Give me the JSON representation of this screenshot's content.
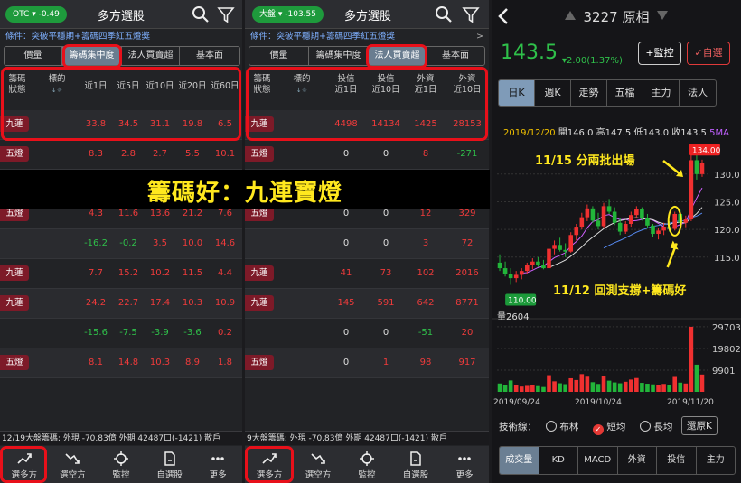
{
  "left": {
    "index_pill": "OTC ▾ -0.49",
    "title": "多方選股",
    "condition": "條件：突破平穩期+籌碼四季紅五燈獎",
    "tabs": [
      "價量",
      "籌碼集中度",
      "法人買賣超",
      "基本面"
    ],
    "active_tab": 1,
    "headers": [
      "籌碼\n狀態",
      "標的",
      "近1日",
      "近5日",
      "近10日",
      "近20日",
      "近60日"
    ],
    "rows": [
      {
        "status": "九蓮",
        "values": [
          "33.8",
          "34.5",
          "31.1",
          "19.8",
          "6.5"
        ]
      },
      {
        "status": "五燈",
        "values": [
          "8.3",
          "2.8",
          "2.7",
          "5.5",
          "10.1"
        ]
      },
      {
        "status": "",
        "values": [
          "",
          "",
          "",
          "",
          ""
        ]
      },
      {
        "status": "五燈",
        "values": [
          "4.3",
          "11.6",
          "13.6",
          "21.2",
          "7.6"
        ]
      },
      {
        "status": "",
        "values": [
          "-16.2",
          "-0.2",
          "3.5",
          "10.0",
          "14.6"
        ]
      },
      {
        "status": "九蓮",
        "values": [
          "7.7",
          "15.2",
          "10.2",
          "11.5",
          "4.4"
        ]
      },
      {
        "status": "九蓮",
        "values": [
          "24.2",
          "22.7",
          "17.4",
          "10.3",
          "10.9"
        ]
      },
      {
        "status": "",
        "values": [
          "-15.6",
          "-7.5",
          "-3.9",
          "-3.6",
          "0.2"
        ]
      },
      {
        "status": "五燈",
        "values": [
          "8.1",
          "14.8",
          "10.3",
          "8.9",
          "1.8"
        ]
      }
    ],
    "ticker": "12/19大盤籌碼: 外現 -70.83億 外期 42487口(-1421) 散戶",
    "nav": [
      "選多方",
      "選空方",
      "監控",
      "自選股",
      "更多"
    ]
  },
  "mid": {
    "index_pill": "大盤 ▾ -103.55",
    "title": "多方選股",
    "condition": "條件：突破平穩期+籌碼四季紅五燈獎",
    "tabs": [
      "價量",
      "籌碼集中度",
      "法人買賣超",
      "基本面"
    ],
    "active_tab": 2,
    "headers": [
      "籌碼\n狀態",
      "標的",
      "投信\n近1日",
      "投信\n近10日",
      "外資\n近1日",
      "外資\n近10日"
    ],
    "rows": [
      {
        "status": "九蓮",
        "values": [
          "4498",
          "14134",
          "1425",
          "28153"
        ]
      },
      {
        "status": "五燈",
        "values": [
          "0",
          "0",
          "8",
          "-271"
        ]
      },
      {
        "status": "",
        "values": [
          "",
          "",
          "",
          ""
        ]
      },
      {
        "status": "五燈",
        "values": [
          "0",
          "0",
          "12",
          "329"
        ]
      },
      {
        "status": "",
        "values": [
          "0",
          "0",
          "3",
          "72"
        ]
      },
      {
        "status": "九蓮",
        "values": [
          "41",
          "73",
          "102",
          "2016"
        ]
      },
      {
        "status": "九蓮",
        "values": [
          "145",
          "591",
          "642",
          "8771"
        ]
      },
      {
        "status": "",
        "values": [
          "0",
          "0",
          "-51",
          "20"
        ]
      },
      {
        "status": "五燈",
        "values": [
          "0",
          "1",
          "98",
          "917"
        ]
      }
    ],
    "ticker": "9大盤籌碼: 外現 -70.83億 外期 42487口(-1421) 散戶",
    "nav": [
      "選多方",
      "選空方",
      "監控",
      "自選股",
      "更多"
    ]
  },
  "banner": "籌碼好：九連寶燈",
  "right": {
    "title": "3227 原相",
    "price": "143.5",
    "change": "▾2.00(1.37%)",
    "monitor_btn": "+監控",
    "watch_btn": "✓自選",
    "tabs": [
      "日K",
      "週K",
      "走勢",
      "五檔",
      "主力",
      "法人"
    ],
    "ohlc_date": "2019/12/20",
    "ohlc_text": "開146.0 高147.5 低143.0 收143.5",
    "ohlc_ma": "5MA",
    "price_ticks": [
      "130.0",
      "125.0",
      "120.0",
      "115.0"
    ],
    "high_label": "134.00",
    "low_label": "110.00",
    "annotation_top": "11/15 分兩批出場",
    "annotation_bottom": "11/12 回測支撐+籌碼好",
    "volume_label": "量2604",
    "volume_ticks": [
      "29703",
      "19802",
      "9901"
    ],
    "dates": [
      "2019/09/24",
      "2019/10/24",
      "2019/11/20"
    ],
    "indicator_label": "技術線：",
    "ma_options": [
      "布林",
      "短均",
      "長均"
    ],
    "restore_btn": "還原K",
    "indicator_tabs": [
      "成交量",
      "KD",
      "MACD",
      "外資",
      "投信",
      "主力"
    ],
    "candles": [
      {
        "o": 114.0,
        "h": 115.5,
        "l": 112.5,
        "c": 113.0
      },
      {
        "o": 113.0,
        "h": 114.2,
        "l": 111.5,
        "c": 112.0
      },
      {
        "o": 112.0,
        "h": 113.0,
        "l": 110.0,
        "c": 111.2
      },
      {
        "o": 111.2,
        "h": 112.5,
        "l": 110.5,
        "c": 111.8
      },
      {
        "o": 111.8,
        "h": 113.0,
        "l": 111.0,
        "c": 112.5
      },
      {
        "o": 112.5,
        "h": 114.0,
        "l": 112.0,
        "c": 113.5
      },
      {
        "o": 113.5,
        "h": 114.8,
        "l": 112.8,
        "c": 114.2
      },
      {
        "o": 114.2,
        "h": 115.0,
        "l": 113.2,
        "c": 113.6
      },
      {
        "o": 113.6,
        "h": 114.5,
        "l": 112.8,
        "c": 113.0
      },
      {
        "o": 113.0,
        "h": 117.0,
        "l": 112.8,
        "c": 116.5
      },
      {
        "o": 116.5,
        "h": 118.0,
        "l": 115.5,
        "c": 117.2
      },
      {
        "o": 117.2,
        "h": 118.5,
        "l": 116.0,
        "c": 116.3
      },
      {
        "o": 116.3,
        "h": 117.5,
        "l": 115.0,
        "c": 116.0
      },
      {
        "o": 116.0,
        "h": 119.5,
        "l": 115.8,
        "c": 119.0
      },
      {
        "o": 119.0,
        "h": 121.0,
        "l": 118.0,
        "c": 120.5
      },
      {
        "o": 120.5,
        "h": 123.0,
        "l": 120.0,
        "c": 122.2
      },
      {
        "o": 122.2,
        "h": 124.5,
        "l": 121.5,
        "c": 123.8
      },
      {
        "o": 123.8,
        "h": 124.2,
        "l": 121.2,
        "c": 121.6
      },
      {
        "o": 121.6,
        "h": 123.0,
        "l": 120.0,
        "c": 120.6
      },
      {
        "o": 120.6,
        "h": 124.8,
        "l": 120.2,
        "c": 124.2
      },
      {
        "o": 124.2,
        "h": 125.5,
        "l": 122.8,
        "c": 123.2
      },
      {
        "o": 123.2,
        "h": 124.0,
        "l": 120.8,
        "c": 121.2
      },
      {
        "o": 121.2,
        "h": 122.0,
        "l": 119.0,
        "c": 119.6
      },
      {
        "o": 119.6,
        "h": 121.5,
        "l": 119.2,
        "c": 121.0
      },
      {
        "o": 121.0,
        "h": 123.2,
        "l": 120.5,
        "c": 122.6
      },
      {
        "o": 122.6,
        "h": 124.2,
        "l": 122.0,
        "c": 123.7
      },
      {
        "o": 123.7,
        "h": 124.0,
        "l": 121.6,
        "c": 122.1
      },
      {
        "o": 122.1,
        "h": 122.8,
        "l": 120.2,
        "c": 120.7
      },
      {
        "o": 120.7,
        "h": 121.0,
        "l": 118.6,
        "c": 119.2
      },
      {
        "o": 119.2,
        "h": 120.3,
        "l": 118.2,
        "c": 119.8
      },
      {
        "o": 119.8,
        "h": 121.2,
        "l": 119.0,
        "c": 120.5
      },
      {
        "o": 120.5,
        "h": 121.5,
        "l": 119.6,
        "c": 120.1
      },
      {
        "o": 120.1,
        "h": 123.2,
        "l": 119.8,
        "c": 122.8
      },
      {
        "o": 122.8,
        "h": 123.5,
        "l": 120.8,
        "c": 121.2
      },
      {
        "o": 121.2,
        "h": 122.5,
        "l": 120.4,
        "c": 121.8
      },
      {
        "o": 121.8,
        "h": 134.0,
        "l": 121.5,
        "c": 132.5
      },
      {
        "o": 132.5,
        "h": 133.5,
        "l": 129.0,
        "c": 130.0
      },
      {
        "o": 130.0,
        "h": 132.6,
        "l": 129.5,
        "c": 132.0
      }
    ],
    "volumes": [
      3800,
      2900,
      5200,
      3100,
      2400,
      2700,
      3300,
      2600,
      2200,
      7600,
      4800,
      3900,
      3500,
      6200,
      5400,
      8100,
      6900,
      4400,
      3600,
      7200,
      5100,
      4300,
      3900,
      4600,
      5600,
      6300,
      4100,
      3700,
      3400,
      3200,
      3600,
      3000,
      6800,
      4200,
      3800,
      29703,
      12400,
      7900
    ]
  }
}
